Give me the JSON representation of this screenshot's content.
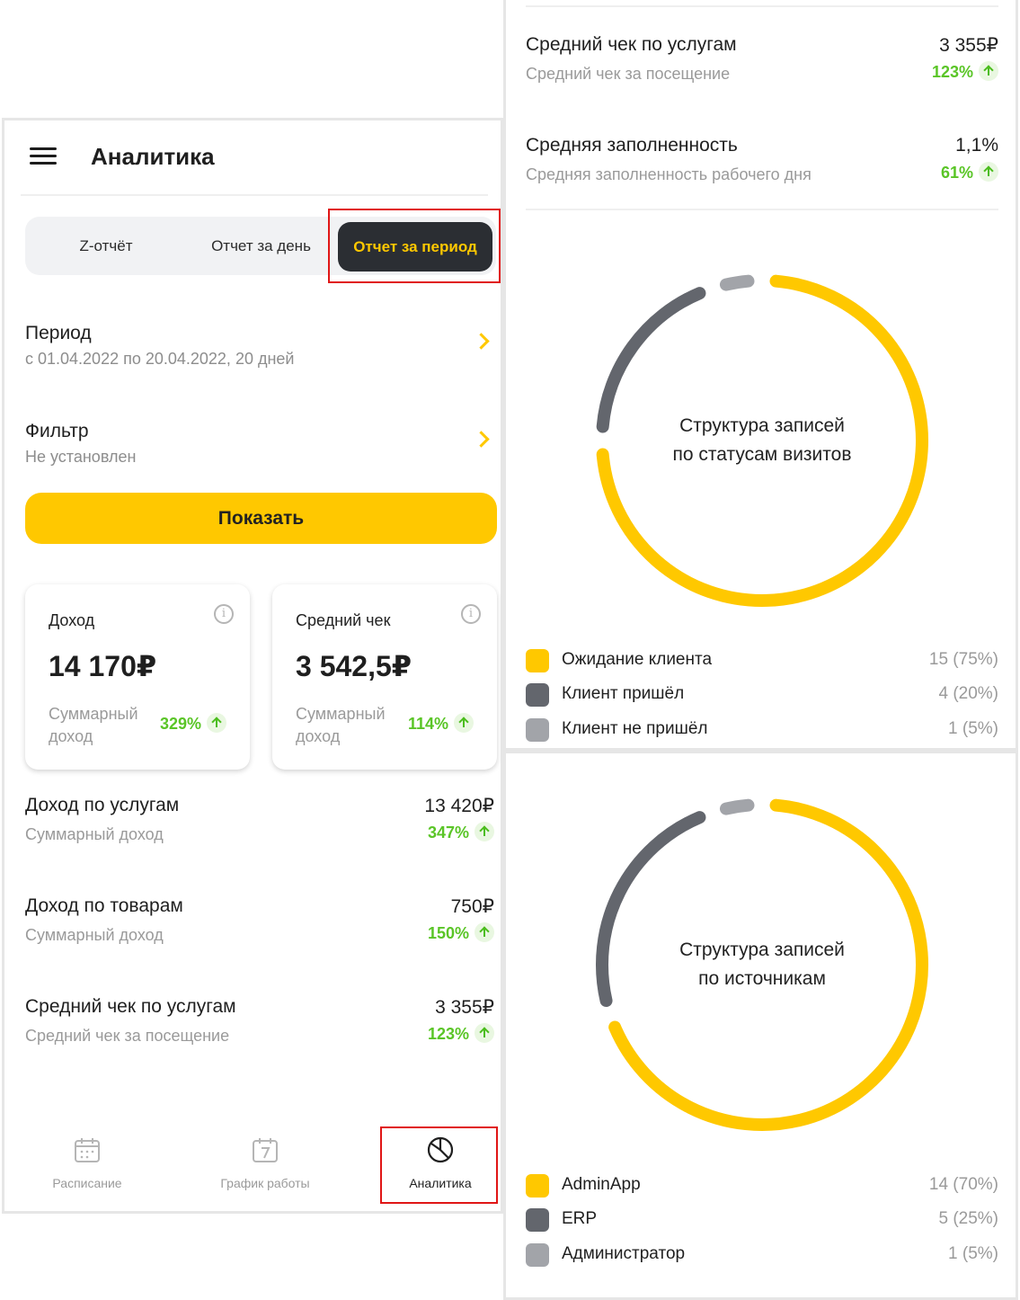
{
  "header": {
    "title": "Аналитика"
  },
  "tabs": [
    {
      "label": "Z-отчёт"
    },
    {
      "label": "Отчет за день"
    },
    {
      "label": "Отчет за период"
    }
  ],
  "period": {
    "title": "Период",
    "value": "с 01.04.2022 по 20.04.2022, 20 дней"
  },
  "filter": {
    "title": "Фильтр",
    "value": "Не установлен"
  },
  "show_button": "Показать",
  "cards": [
    {
      "label": "Доход",
      "value": "14 170₽",
      "sub": "Суммарный доход",
      "pct": "329%"
    },
    {
      "label": "Средний чек",
      "value": "3 542,5₽",
      "sub": "Суммарный доход",
      "pct": "114%"
    }
  ],
  "metrics_left": [
    {
      "title": "Доход по услугам",
      "sub": "Суммарный доход",
      "value": "13 420₽",
      "pct": "347%"
    },
    {
      "title": "Доход по товарам",
      "sub": "Суммарный доход",
      "value": "750₽",
      "pct": "150%"
    },
    {
      "title": "Средний чек по услугам",
      "sub": "Средний чек за посещение",
      "value": "3 355₽",
      "pct": "123%"
    }
  ],
  "bottom_nav": [
    {
      "label": "Расписание",
      "icon": "calendar-icon"
    },
    {
      "label": "График работы",
      "icon": "calendar-7-icon"
    },
    {
      "label": "Аналитика",
      "icon": "pie-chart-icon"
    }
  ],
  "metrics_right": [
    {
      "title": "Средний чек по услугам",
      "sub": "Средний чек за посещение",
      "value": "3 355₽",
      "pct": "123%"
    },
    {
      "title": "Средняя заполненность",
      "sub": "Средняя заполненность рабочего дня",
      "value": "1,1%",
      "pct": "61%"
    }
  ],
  "colors": {
    "accent": "#ffc800",
    "dark": "#63666d",
    "gray": "#a2a4a9",
    "positive": "#5ac527",
    "highlight": "#e01616"
  },
  "chart_data": [
    {
      "type": "pie",
      "title_lines": [
        "Структура записей",
        "по статусам визитов"
      ],
      "categories": [
        "Ожидание клиента",
        "Клиент пришёл",
        "Клиент не пришёл"
      ],
      "values": [
        15,
        4,
        1
      ],
      "labels": [
        "15 (75%)",
        "4 (20%)",
        "1 (5%)"
      ],
      "colors": [
        "#ffc800",
        "#63666d",
        "#a2a4a9"
      ]
    },
    {
      "type": "pie",
      "title_lines": [
        "Структура записей",
        "по источникам"
      ],
      "categories": [
        "AdminApp",
        "ERP",
        "Администратор"
      ],
      "values": [
        14,
        5,
        1
      ],
      "labels": [
        "14 (70%)",
        "5 (25%)",
        "1 (5%)"
      ],
      "colors": [
        "#ffc800",
        "#63666d",
        "#a2a4a9"
      ]
    }
  ]
}
